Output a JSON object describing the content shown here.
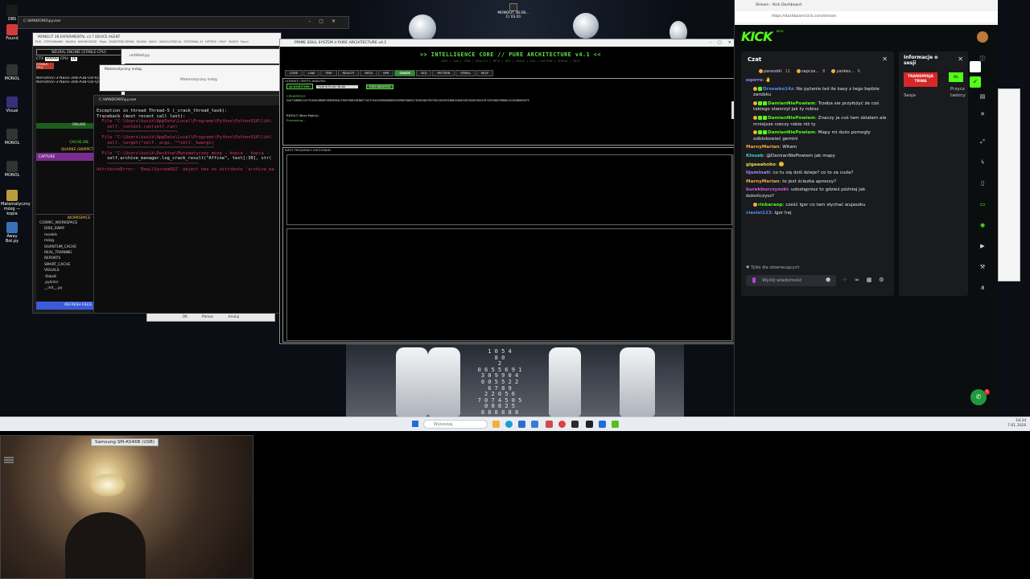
{
  "desktop": {
    "icons": [
      {
        "label": "OBS",
        "color": "#1b1b1b"
      },
      {
        "label": "Found",
        "color": "#d13b3b"
      },
      {
        "label": "MONOL",
        "color": "#333"
      },
      {
        "label": "Visual",
        "color": "#3a2d7a"
      },
      {
        "label": "MONOL",
        "color": "#333"
      },
      {
        "label": "MONOL",
        "color": "#333"
      },
      {
        "label": "Matematyczny mózg — kopia",
        "color": "#b99b3a"
      },
      {
        "label": "Away Bot.py",
        "color": "#3a6fb9"
      }
    ],
    "top_icon_label": "MONOLIT 3B EN...",
    "top_icon_sub": "Cr 03.01"
  },
  "neural_window": {
    "title": "MONOLIT 3B EXPERIMENTAL v3.7 DEVICE AGENT",
    "menu": [
      "PLIK",
      "STEROWANIE",
      "NAUKA",
      "KNOWLEDGE",
      "Tools",
      "ZABEZPIECZENIA",
      "ZŁAMA",
      "NASS",
      "ABSOLUTNECIA",
      "EXTERNAL AI",
      "OPTERS",
      "HELP",
      "MAZHI",
      "Poprz"
    ],
    "engine_title": "NEURAL ENGINE [STABLE-CPU]",
    "ctx_label": "CTX",
    "ctx_value": "99999",
    "cpu_label": "CPU:",
    "cpu_value": "16",
    "stable_badge": "[STABLE-CPU]",
    "models": [
      "Nemotron-3-Nano-30B-A3B-UD-IQ2_M-rmp.gguf",
      "Nemotron-3-Nano-30B-A3B-UD-Q4_K_XL.gguf"
    ],
    "online_label": "ONLINE",
    "loading_label": "Ładowanie: 0%",
    "cache_label": "CACHE:ON",
    "quarks_label": "QUARKS (SNIPPETS)",
    "capture_label": "CAPTURE",
    "workspace_title": "WORKSPACE",
    "workspace_items": [
      "COSMIC_WORKSPACE",
      "DISK_SWAP",
      "models",
      "mózg",
      "QUANTUM_CACHE",
      "REAL_TRAINING",
      "REPORTS",
      "SMART_CACHE",
      "VISUALS",
      ".flake8",
      ".pylintrc",
      "__init__.py"
    ],
    "refresh_button": "REFRESH FILES"
  },
  "editor": {
    "tab": "untitled.py",
    "buttons": [
      "OK",
      "Pomoc",
      "Anuluj"
    ]
  },
  "browser_small": {
    "tab": "Matematyczny mózg",
    "breadcrumb": "Matematyczny mózg"
  },
  "console": {
    "title": "C:\\WINDOWS\\py.exe",
    "lines": [
      {
        "t": "Exception in thread Thread-5 (_crack_thread_task):",
        "c": "n"
      },
      {
        "t": "Traceback (most recent call last):",
        "c": "n"
      },
      {
        "t": "  File \"C:\\Users\\kusik\\AppData\\Local\\Programs\\Python\\Python310\\lib\\",
        "c": "e"
      },
      {
        "t": "    self._context.run(self.run)",
        "c": "e"
      },
      {
        "t": "    ~~~~~~~~~~~~~~~~~~~~~~~~~~~",
        "c": "d"
      },
      {
        "t": "  File \"C:\\Users\\kusik\\AppData\\Local\\Programs\\Python\\Python310\\lib\\",
        "c": "e"
      },
      {
        "t": "    self._target(*self._args, **self._kwargs)",
        "c": "e"
      },
      {
        "t": "    ~~~~~~~~~~~~~~~~~~~~~~~~~~~~~~~~~~~~~~~~~",
        "c": "d"
      },
      {
        "t": "  File \"C:\\Users\\kusik\\Desktop\\Matematyczny mózg - kopia - kopia -",
        "c": "e"
      },
      {
        "t": "    self.archive_manager.log_crack_result(\"Affine\", text[:30], str(",
        "c": "n"
      },
      {
        "t": "    ~~~~~~~~~~~~~~~~~~~~~~~~~~~~~~~~~~~",
        "c": "d"
      },
      {
        "t": "AttributeError: 'EmailSystemGUI' object has no attribute 'archive_ma",
        "c": "e"
      }
    ]
  },
  "app": {
    "window_title": "PRIME SOUL SYSTEM // PURE ARCHITECTURE v4.1",
    "header": ">> INTELLIGENCE CORE // PURE ARCHITECTURE v4.1 <<",
    "subheader": "CORE | LAW | TIME | REALITY | META | NPR | CRACK | SEQ | PATTERN | SPIRAL | HELP",
    "tabs": [
      "CORE",
      "LAW",
      "TIME",
      "REALITY",
      "META",
      "NPR",
      "CRACK",
      "SEQ",
      "PATTERN",
      "SPIRAL",
      "HELP"
    ],
    "active_tab": "CRACK",
    "analysis_label": "ULTIMATE CRYPTO ANALYSIS",
    "algorithm_label": "ALGORITHM:",
    "algorithm_value": "Hybrid Enum Brute",
    "run_button": "RUN ANALYSIS",
    "ciphertext_label": "CIPHERTEXT:",
    "ciphertext": "54471588811417518451886874883556427505798823638677423744243990508803535906766831762634047057561104349180615460318318402203478743310057680614220386692675",
    "result_label": "RESULT (Best Match):",
    "processing": "Processing...",
    "histogram_label": "INPUT FREQUENCY HISTOGRAM"
  },
  "matrix_text": "1 0 5 4\n8 0\n2\n0 6 5 5 6 9 1\n3 0 9 9 0 4\n0 0 5 5 2 2\n6 7 8 9\n2 2 0 5 6\n7 0 7 4 5 0 5\n0 0 8 2 5\n8 8 8 8 8 8\n8 0\n3 8 0 6 7 3\n2 2 4 0 5 6\n3 7 7 8 2 3\n0 0 0 2 2 2 2\n0 0 0 0 0 0 0",
  "taskbar": {
    "search_placeholder": "Wyszukaj",
    "time": "18:34",
    "date": "7.01.2026"
  },
  "kick": {
    "tab_title": "Stream - Kick Dashboard",
    "url": "https://dashboard.kick.com/stream",
    "logo": "KICK",
    "logo_sup": "BETA",
    "chat_title": "Czat",
    "top_chatters": [
      {
        "name": "parasolki",
        "count": "11"
      },
      {
        "name": "sapcza...",
        "count": "8"
      },
      {
        "name": "yankes...",
        "count": "6"
      }
    ],
    "messages": [
      {
        "user": "sqorro",
        "color": "#9b8cf5",
        "text": "🤚",
        "badges": []
      },
      {
        "user": "Drzewko14z",
        "color": "#5a8cf0",
        "text": "No pytanie też ile kasy z tego będzie zarobku",
        "badges": [
          "y",
          "g"
        ]
      },
      {
        "user": "DamianNiePowiem",
        "color": "#53fc18",
        "text": "Trzeba sie przyłożyć że coś takiego stworzył jak ty robisz",
        "badges": [
          "y",
          "g",
          "g"
        ]
      },
      {
        "user": "DamianNiePowiem",
        "color": "#53fc18",
        "text": "Znaczy ja coś tam działam ale mniejsze rzeczy robie niż ty",
        "badges": [
          "y",
          "g",
          "g"
        ]
      },
      {
        "user": "DamianNiePowiem",
        "color": "#53fc18",
        "text": "Mapy mi dużo pomogły odblokowieć gemini",
        "badges": [
          "y",
          "g",
          "g"
        ]
      },
      {
        "user": "MarnyMarian",
        "color": "#f2a94a",
        "text": "Witam",
        "badges": []
      },
      {
        "user": "Klouek",
        "color": "#3fd1c6",
        "text": "@DamianNiePowiem jak mapy",
        "badges": []
      },
      {
        "user": "gigaaabobo",
        "color": "#e8d84a",
        "text": "🙂",
        "badges": []
      },
      {
        "user": "lijuminati",
        "color": "#9b8cf5",
        "text": "co tu się dziś dzieje? co to za cuda?",
        "badges": []
      },
      {
        "user": "MarnyMarian",
        "color": "#f2a94a",
        "text": "to jest ściezka aproxxy?",
        "badges": []
      },
      {
        "user": "burekburczynski",
        "color": "#d35bd6",
        "text": "udostępnisz to gdzieś później jak dokończysz?",
        "badges": []
      },
      {
        "user": "rinkaraop",
        "color": "#53fc18",
        "text": "cześć Igor co tam słychać wujaszku",
        "badges": [
          "y"
        ]
      },
      {
        "user": "ciesiel123",
        "color": "#5a8cf0",
        "text": "Igor hej",
        "badges": []
      }
    ],
    "followers_only": "Tylko dla obserwujących",
    "message_placeholder": "Wyślij wiadomość",
    "session_title": "Informacje o sesji",
    "live_badge": "TRANSMISJA TRWA",
    "session_label": "Sesja",
    "creator_label_1": "Przycz",
    "creator_label_2": "twórcy",
    "notif_count": "1"
  },
  "camera": {
    "label": "Samsung SM-A546B (USB)"
  }
}
